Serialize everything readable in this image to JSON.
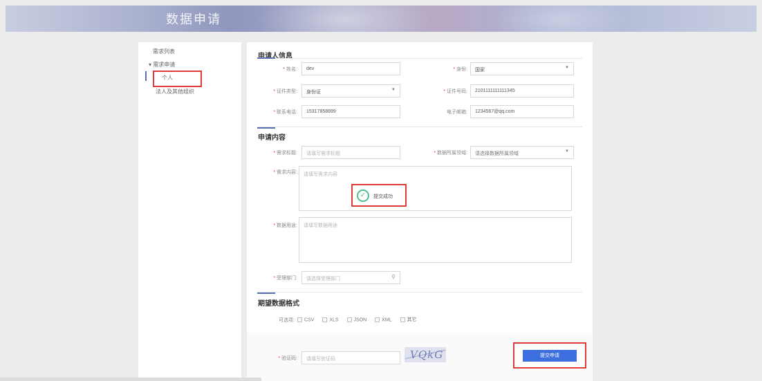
{
  "banner": {
    "title": "数据申请"
  },
  "sidebar": {
    "items": [
      {
        "label": "需求列表"
      },
      {
        "label": "▾ 需求申请"
      },
      {
        "label": "个人"
      },
      {
        "label": "法人及其他组织"
      }
    ]
  },
  "applicant": {
    "section_title": "申请人信息",
    "name": {
      "label": "姓名:",
      "value": "dev"
    },
    "identity": {
      "label": "身份:",
      "value": "国家"
    },
    "id_type": {
      "label": "证件类型:",
      "value": "身份证"
    },
    "id_number": {
      "label": "证件号码:",
      "value": "2101111111111345"
    },
    "phone": {
      "label": "联系电话:",
      "value": "15317858899"
    },
    "email": {
      "label": "电子邮箱:",
      "value": "1234567@qq.com"
    }
  },
  "content": {
    "section_title": "申请内容",
    "req_title": {
      "label": "需求标题:",
      "placeholder": "请填写需求标题"
    },
    "domain": {
      "label": "数据所属领域:",
      "placeholder": "请选择数据所属领域"
    },
    "req_content": {
      "label": "需求内容:",
      "placeholder": "请填写需求内容"
    },
    "data_usage": {
      "label": "数据用途:",
      "placeholder": "请填写数据用途"
    },
    "dept": {
      "label": "受理部门:",
      "placeholder": "请选择受理部门"
    }
  },
  "toast": {
    "message": "提交成功"
  },
  "format": {
    "section_title": "期望数据格式",
    "label": "可选项:",
    "options": [
      "CSV",
      "XLS",
      "JSON",
      "XML",
      "其它"
    ]
  },
  "footer": {
    "captcha_label": "验证码:",
    "captcha_placeholder": "请填写验证码",
    "captcha_text": "VQkG",
    "submit_label": "提交申请"
  }
}
